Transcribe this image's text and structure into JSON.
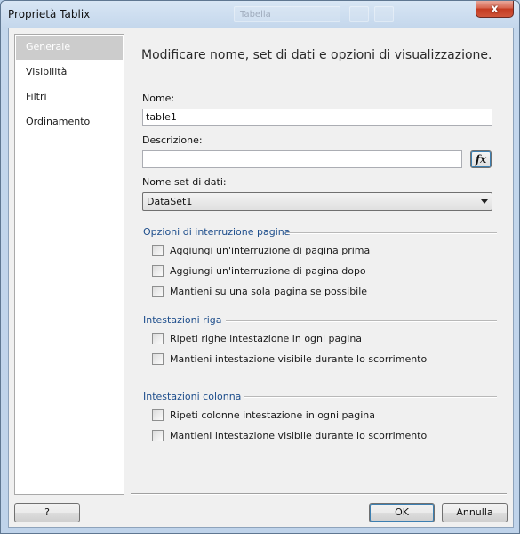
{
  "window": {
    "title": "Proprietà Tablix",
    "close_glyph": "x",
    "background_ghost_text": "Tabella"
  },
  "nav": {
    "items": [
      {
        "label": "Generale",
        "active": true
      },
      {
        "label": "Visibilità",
        "active": false
      },
      {
        "label": "Filtri",
        "active": false
      },
      {
        "label": "Ordinamento",
        "active": false
      }
    ]
  },
  "main": {
    "heading": "Modificare nome, set di dati e opzioni di visualizzazione.",
    "name_label": "Nome:",
    "name_value": "table1",
    "description_label": "Descrizione:",
    "description_value": "",
    "fx_label": "fx",
    "dataset_label": "Nome set di dati:",
    "dataset_value": "DataSet1"
  },
  "groups": {
    "page_break": {
      "title": "Opzioni di interruzione pagina",
      "options": [
        {
          "label": "Aggiungi un'interruzione di pagina prima",
          "checked": false
        },
        {
          "label": "Aggiungi un'interruzione di pagina dopo",
          "checked": false
        },
        {
          "label": "Mantieni su una sola pagina se possibile",
          "checked": false
        }
      ]
    },
    "row_headers": {
      "title": "Intestazioni riga",
      "options": [
        {
          "label": "Ripeti righe intestazione in ogni pagina",
          "checked": false
        },
        {
          "label": "Mantieni intestazione visibile durante lo scorrimento",
          "checked": false
        }
      ]
    },
    "column_headers": {
      "title": "Intestazioni colonna",
      "options": [
        {
          "label": "Ripeti colonne intestazione in ogni pagina",
          "checked": false
        },
        {
          "label": "Mantieni intestazione visibile durante lo scorrimento",
          "checked": false
        }
      ]
    }
  },
  "footer": {
    "help_label": "?",
    "ok_label": "OK",
    "cancel_label": "Annulla"
  },
  "colors": {
    "group_title": "#1e4e8c",
    "window_frame": "#bfd3ea",
    "close_button": "#c43c22"
  }
}
